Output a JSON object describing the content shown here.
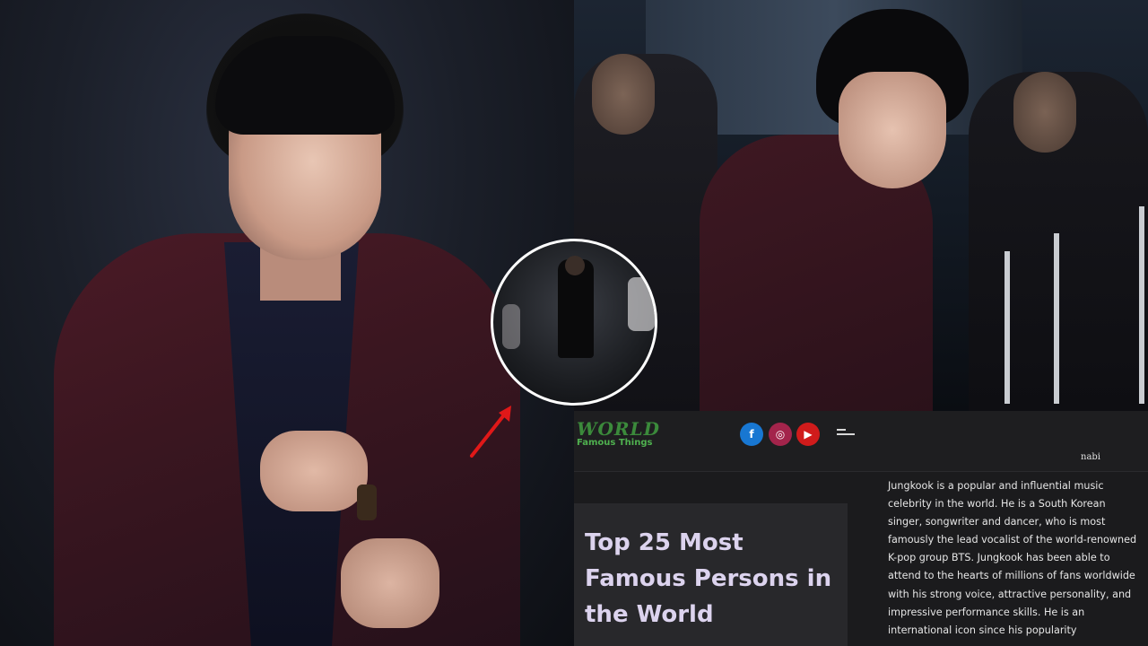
{
  "website": {
    "logo": {
      "line1": "WORLD",
      "line2": "Famous Things"
    },
    "social": {
      "facebook": "f",
      "instagram": "◎",
      "youtube": "▶"
    },
    "author": "nabi",
    "article_title": "Top 25 Most Famous Persons in the World",
    "article_body": "Jungkook is a popular and influential music celebrity in the world. He is a South Korean singer, songwriter and dancer, who is most famously the lead vocalist of the world-renowned K-pop group BTS. Jungkook has been able to attend to the hearts of millions of fans worldwide with his strong voice, attractive personality, and impressive performance skills. He is an international icon since his popularity"
  },
  "colors": {
    "facebook": "#1877d2",
    "instagram": "#a3244b",
    "youtube": "#d01b1b",
    "arrow": "#e01818",
    "title_text": "#dcd3ee",
    "logo_green": "#3b8a3b"
  }
}
